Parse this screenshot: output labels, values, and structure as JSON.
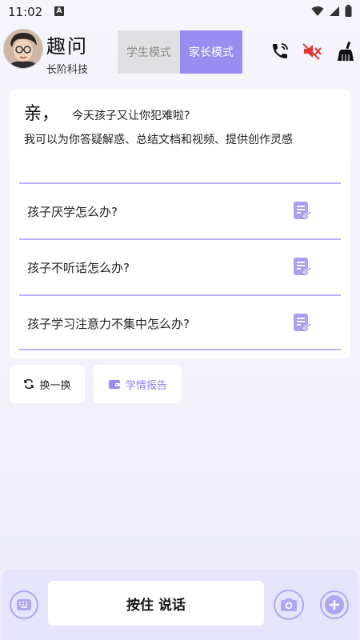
{
  "status": {
    "time": "11:02",
    "a_badge": "A"
  },
  "header": {
    "title": "趣问",
    "subtitle": "长阶科技",
    "modes": [
      {
        "label": "学生模式",
        "active": false
      },
      {
        "label": "家长模式",
        "active": true
      }
    ]
  },
  "card": {
    "greeting_title": "亲，",
    "greeting_question": "今天孩子又让你犯难啦?",
    "description": "我可以为你答疑解惑、总结文档和视频、提供创作灵感",
    "questions": [
      "孩子厌学怎么办?",
      "孩子不听话怎么办?",
      "孩子学习注意力不集中怎么办?"
    ]
  },
  "actions": {
    "refresh_label": "换一换",
    "report_label": "学情报告"
  },
  "input": {
    "press_talk_label": "按住 说话"
  },
  "colors": {
    "accent": "#9a8df2",
    "divider": "#b9b2f3",
    "mute_red": "#e53935"
  }
}
